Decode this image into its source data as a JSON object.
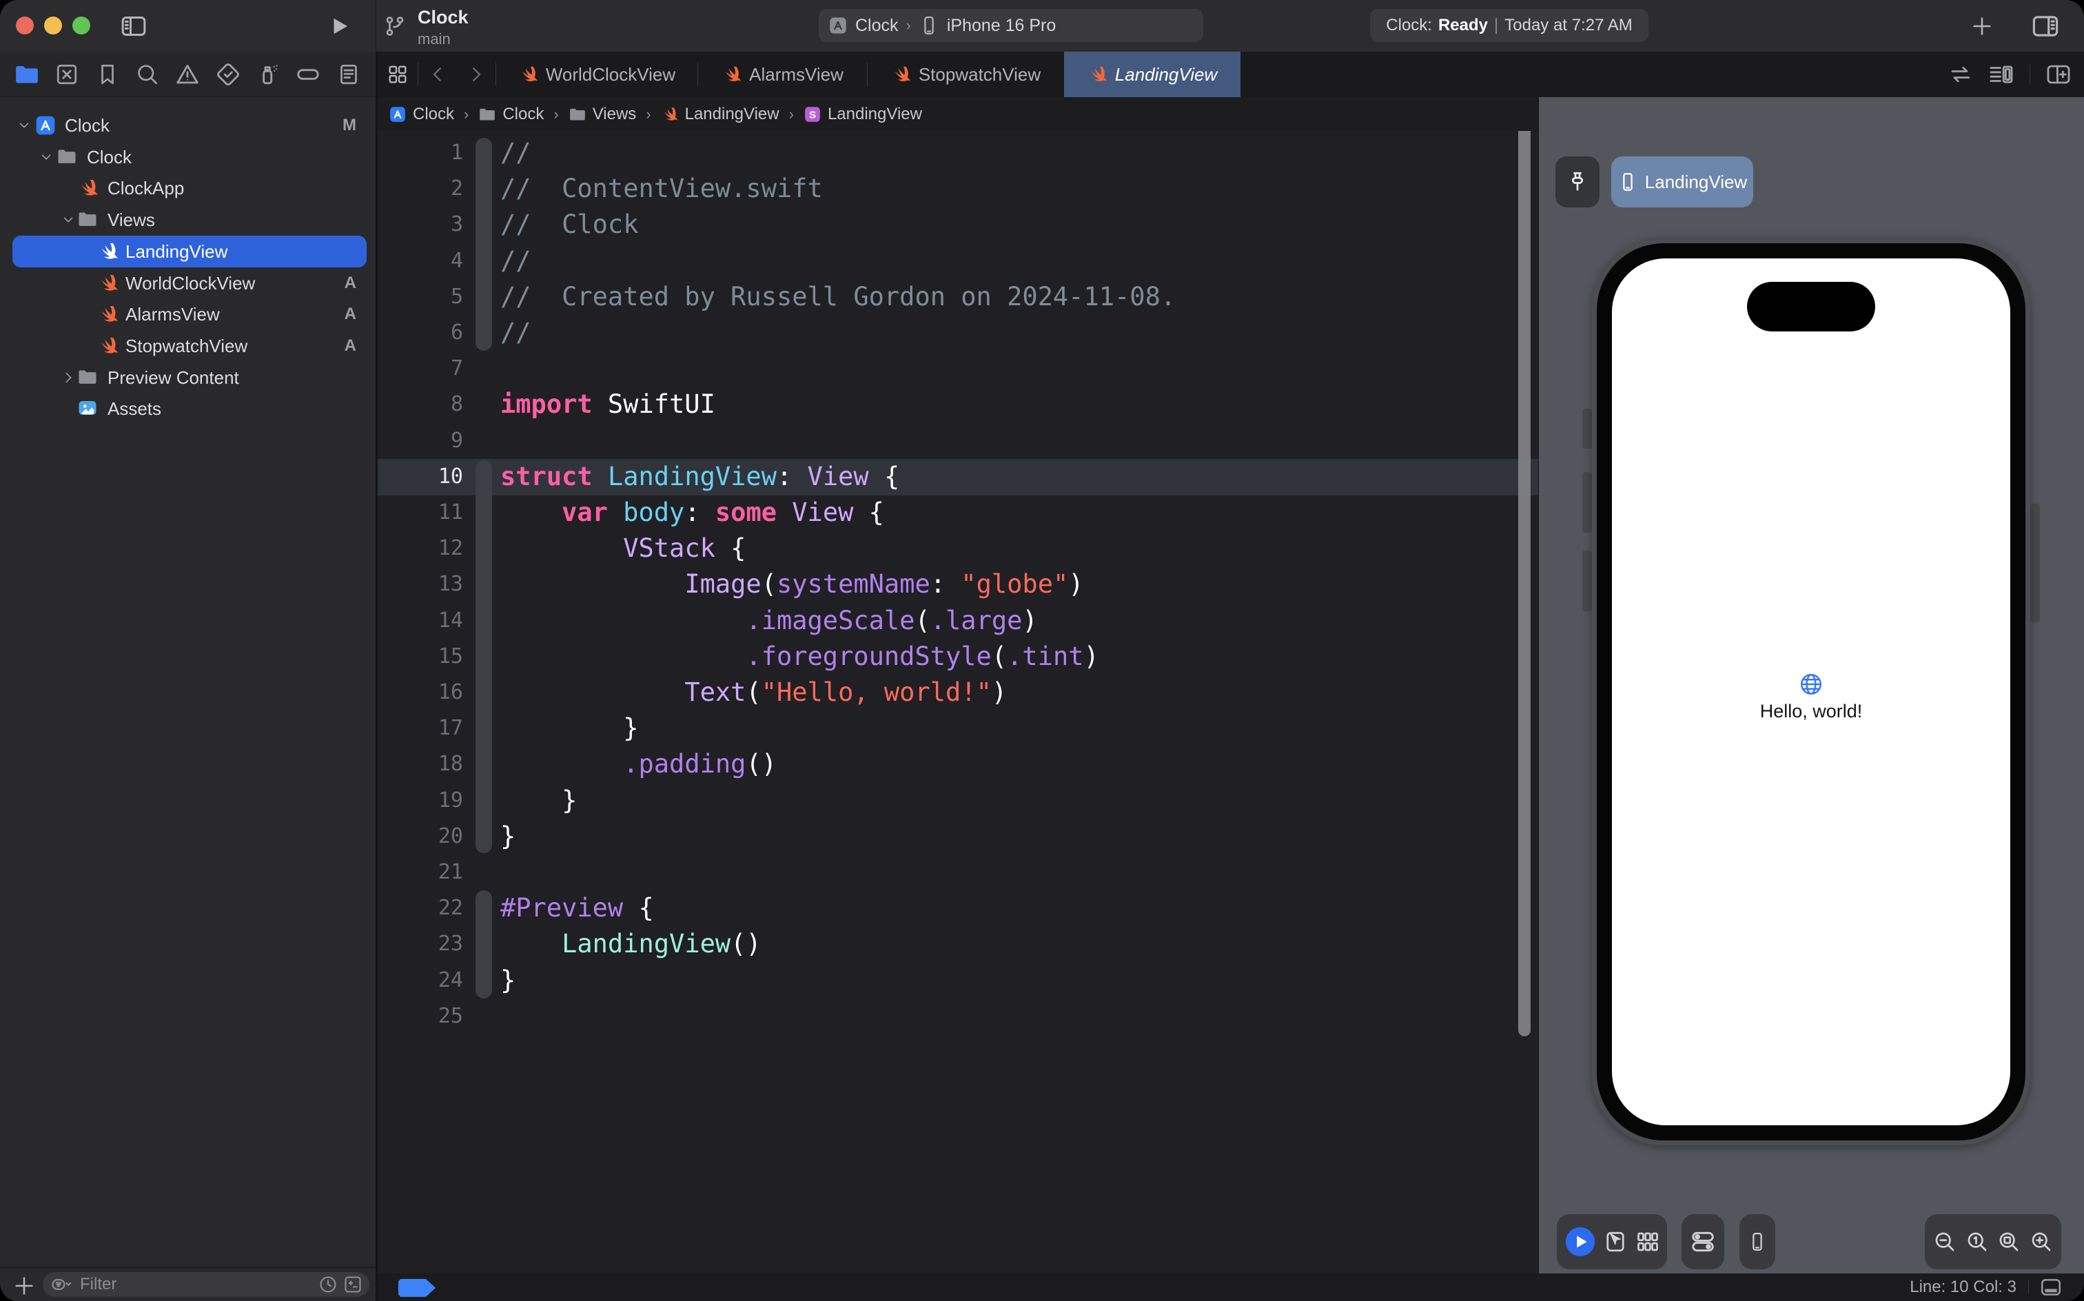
{
  "window": {
    "project": "Clock",
    "branch": "main"
  },
  "toolbar": {
    "scheme": {
      "target": "Clock",
      "separator": "›",
      "device": "iPhone 16 Pro"
    },
    "status": {
      "app": "Clock:",
      "state": "Ready",
      "divider": "|",
      "time": "Today at 7:27 AM"
    }
  },
  "sidebar": {
    "nav_icons": [
      "project-navigator",
      "source-control",
      "bookmarks",
      "find",
      "issues",
      "tests",
      "debug-gauge",
      "breakpoints",
      "reports"
    ],
    "tree": [
      {
        "label": "Clock",
        "icon": "app",
        "depth": 0,
        "chevron": "down",
        "badge": "M",
        "selected": false
      },
      {
        "label": "Clock",
        "icon": "folder",
        "depth": 1,
        "chevron": "down",
        "badge": "",
        "selected": false
      },
      {
        "label": "ClockApp",
        "icon": "swift",
        "depth": 2,
        "chevron": "",
        "badge": "",
        "selected": false
      },
      {
        "label": "Views",
        "icon": "folder",
        "depth": 2,
        "chevron": "down",
        "badge": "",
        "selected": false
      },
      {
        "label": "LandingView",
        "icon": "swift",
        "depth": 3,
        "chevron": "",
        "badge": "",
        "selected": true
      },
      {
        "label": "WorldClockView",
        "icon": "swift",
        "depth": 3,
        "chevron": "",
        "badge": "A",
        "selected": false
      },
      {
        "label": "AlarmsView",
        "icon": "swift",
        "depth": 3,
        "chevron": "",
        "badge": "A",
        "selected": false
      },
      {
        "label": "StopwatchView",
        "icon": "swift",
        "depth": 3,
        "chevron": "",
        "badge": "A",
        "selected": false
      },
      {
        "label": "Preview Content",
        "icon": "folder",
        "depth": 2,
        "chevron": "right",
        "badge": "",
        "selected": false
      },
      {
        "label": "Assets",
        "icon": "photo",
        "depth": 2,
        "chevron": "",
        "badge": "",
        "selected": false
      }
    ],
    "filter": {
      "placeholder": "Filter"
    }
  },
  "editor": {
    "tabs": [
      {
        "label": "WorldClockView",
        "active": false
      },
      {
        "label": "AlarmsView",
        "active": false
      },
      {
        "label": "StopwatchView",
        "active": false
      },
      {
        "label": "LandingView",
        "active": true
      }
    ],
    "breadcrumb": [
      {
        "icon": "app",
        "label": "Clock"
      },
      {
        "icon": "folder",
        "label": "Clock"
      },
      {
        "icon": "folder",
        "label": "Views"
      },
      {
        "icon": "swift",
        "label": "LandingView"
      },
      {
        "icon": "s-symbol",
        "label": "LandingView"
      }
    ],
    "code": {
      "current_line": 10,
      "lines": [
        [
          [
            "cmt",
            "//"
          ]
        ],
        [
          [
            "cmt",
            "//  ContentView.swift"
          ]
        ],
        [
          [
            "cmt",
            "//  Clock"
          ]
        ],
        [
          [
            "cmt",
            "//"
          ]
        ],
        [
          [
            "cmt",
            "//  Created by Russell Gordon on 2024-11-08."
          ]
        ],
        [
          [
            "cmt",
            "//"
          ]
        ],
        [],
        [
          [
            "kw",
            "import"
          ],
          [
            "pln",
            " SwiftUI"
          ]
        ],
        [],
        [
          [
            "kw",
            "struct"
          ],
          [
            "pln",
            " "
          ],
          [
            "decl",
            "LandingView"
          ],
          [
            "pln",
            ": "
          ],
          [
            "type",
            "View"
          ],
          [
            "pln",
            " {"
          ]
        ],
        [
          [
            "pln",
            "    "
          ],
          [
            "kw",
            "var"
          ],
          [
            "pln",
            " "
          ],
          [
            "decl",
            "body"
          ],
          [
            "pln",
            ": "
          ],
          [
            "kw",
            "some"
          ],
          [
            "pln",
            " "
          ],
          [
            "type",
            "View"
          ],
          [
            "pln",
            " {"
          ]
        ],
        [
          [
            "pln",
            "        "
          ],
          [
            "type",
            "VStack"
          ],
          [
            "pln",
            " {"
          ]
        ],
        [
          [
            "pln",
            "            "
          ],
          [
            "type",
            "Image"
          ],
          [
            "pln",
            "("
          ],
          [
            "fn",
            "systemName"
          ],
          [
            "pln",
            ": "
          ],
          [
            "str",
            "\"globe\""
          ],
          [
            "pln",
            ")"
          ]
        ],
        [
          [
            "pln",
            "                "
          ],
          [
            "fn",
            ".imageScale"
          ],
          [
            "pln",
            "("
          ],
          [
            "fn",
            ".large"
          ],
          [
            "pln",
            ")"
          ]
        ],
        [
          [
            "pln",
            "                "
          ],
          [
            "fn",
            ".foregroundStyle"
          ],
          [
            "pln",
            "("
          ],
          [
            "fn",
            ".tint"
          ],
          [
            "pln",
            ")"
          ]
        ],
        [
          [
            "pln",
            "            "
          ],
          [
            "type",
            "Text"
          ],
          [
            "pln",
            "("
          ],
          [
            "str",
            "\"Hello, world!\""
          ],
          [
            "pln",
            ")"
          ]
        ],
        [
          [
            "pln",
            "        }"
          ]
        ],
        [
          [
            "pln",
            "        "
          ],
          [
            "fn",
            ".padding"
          ],
          [
            "pln",
            "()"
          ]
        ],
        [
          [
            "pln",
            "    }"
          ]
        ],
        [
          [
            "pln",
            "}"
          ]
        ],
        [],
        [
          [
            "fn",
            "#Preview"
          ],
          [
            "pln",
            " {"
          ]
        ],
        [
          [
            "pln",
            "    "
          ],
          [
            "proj",
            "LandingView"
          ],
          [
            "pln",
            "()"
          ]
        ],
        [
          [
            "pln",
            "}"
          ]
        ],
        []
      ]
    },
    "statusbar": {
      "line_col": "Line: 10  Col: 3"
    }
  },
  "preview": {
    "pill_label": "LandingView",
    "hello_text": "Hello, world!"
  },
  "colors": {
    "accent_blue": "#2e62da",
    "tab_active": "#44597e",
    "swift_orange": "#f2683b",
    "globe_blue": "#3478f6"
  }
}
